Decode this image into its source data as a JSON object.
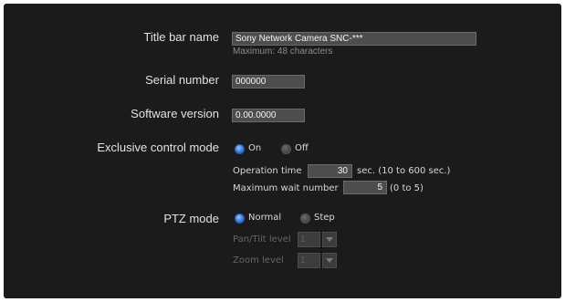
{
  "title_bar": {
    "label": "Title bar name",
    "value": "Sony Network Camera SNC-***",
    "hint": "Maximum: 48 characters"
  },
  "serial": {
    "label": "Serial number",
    "value": "000000"
  },
  "software": {
    "label": "Software version",
    "value": "0.00.0000"
  },
  "exclusive": {
    "label": "Exclusive control mode",
    "option_on": "On",
    "option_off": "Off",
    "selected": "On",
    "operation_time_label": "Operation time",
    "operation_time_value": "30",
    "operation_time_unit": "sec. (10 to 600 sec.)",
    "max_wait_label": "Maximum wait number",
    "max_wait_value": "5",
    "max_wait_range": "(0 to 5)"
  },
  "ptz": {
    "label": "PTZ mode",
    "option_normal": "Normal",
    "option_step": "Step",
    "selected": "Normal",
    "pan_tilt_label": "Pan/Tilt level",
    "pan_tilt_value": "1",
    "zoom_label": "Zoom level",
    "zoom_value": "1"
  }
}
